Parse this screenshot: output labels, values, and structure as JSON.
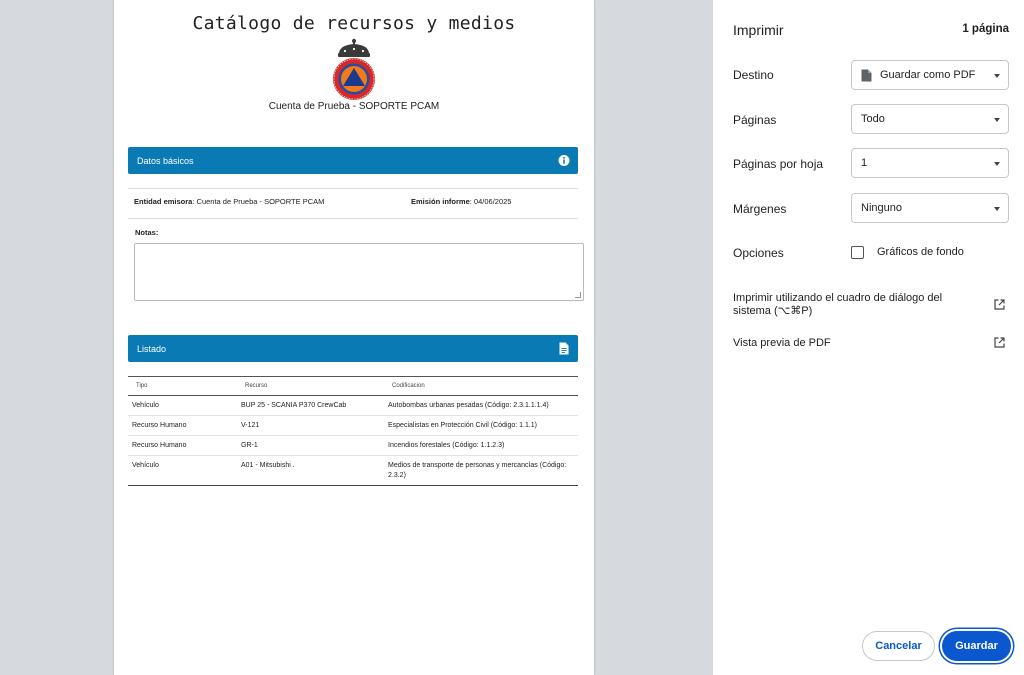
{
  "document": {
    "title": "Catálogo de recursos y medios",
    "organization": "Cuenta de Prueba - SOPORTE PCAM",
    "basic_section": {
      "title": "Datos básicos",
      "issuer_label": "Entidad emisora",
      "issuer_value": ": Cuenta de Prueba - SOPORTE PCAM",
      "date_label": "Emisión informe",
      "date_value": ": 04/06/2025",
      "notes_label": "Notas:"
    },
    "list_section": {
      "title": "Listado",
      "headers": [
        "Tipo",
        "Recurso",
        "Codificacion"
      ],
      "rows": [
        [
          "Vehículo",
          "BUP 25 - SCANIA P370 CrewCab",
          "Autobombas urbanas pesadas (Código: 2.3.1.1.1.4)"
        ],
        [
          "Recurso Humano",
          "V-121",
          "Especialistas en Protección Civil (Código: 1.1.1)"
        ],
        [
          "Recurso Humano",
          "GR-1",
          "Incendios forestales (Código: 1.1.2.3)"
        ],
        [
          "Vehículo",
          "A01 - Mitsubishi .",
          "Medios de transporte de personas y mercancías (Código: 2.3.2)"
        ]
      ]
    },
    "colors": {
      "section_bar": "#0a7ab5"
    }
  },
  "print_panel": {
    "title": "Imprimir",
    "page_count": "1 página",
    "destination": {
      "label": "Destino",
      "value": "Guardar como PDF"
    },
    "pages": {
      "label": "Páginas",
      "value": "Todo"
    },
    "pages_per_sheet": {
      "label": "Páginas por hoja",
      "value": "1"
    },
    "margins": {
      "label": "Márgenes",
      "value": "Ninguno"
    },
    "options": {
      "label": "Opciones",
      "background_graphics": "Gráficos de fondo"
    },
    "system_dialog_link": "Imprimir utilizando el cuadro de diálogo del sistema (⌥⌘P)",
    "pdf_preview_link": "Vista previa de PDF",
    "cancel_button": "Cancelar",
    "save_button": "Guardar",
    "colors": {
      "accent": "#0b57d0"
    }
  }
}
